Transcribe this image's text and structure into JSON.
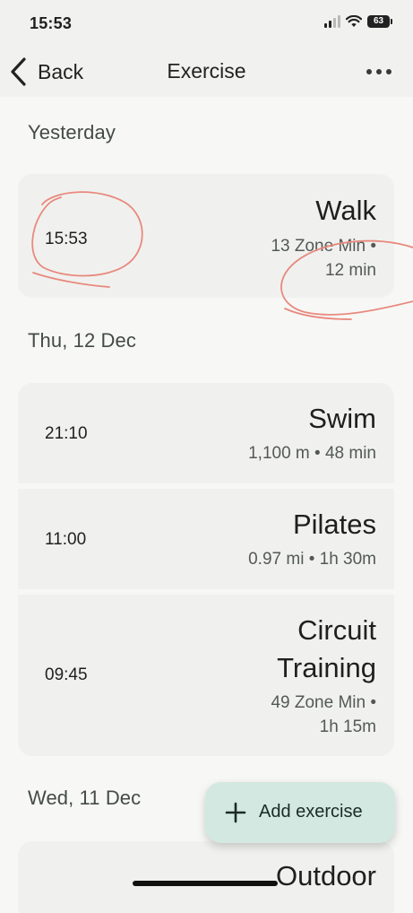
{
  "status_bar": {
    "time": "15:53",
    "battery": "63"
  },
  "header": {
    "back_label": "Back",
    "title": "Exercise"
  },
  "sections": [
    {
      "label": "Yesterday",
      "items": [
        {
          "time": "15:53",
          "name_lines": [
            "Walk"
          ],
          "meta_lines": [
            "13 Zone Min •",
            "12 min"
          ]
        }
      ]
    },
    {
      "label": "Thu, 12 Dec",
      "items": [
        {
          "time": "21:10",
          "name_lines": [
            "Swim"
          ],
          "meta_lines": [
            "1,100 m • 48 min"
          ]
        },
        {
          "time": "11:00",
          "name_lines": [
            "Pilates"
          ],
          "meta_lines": [
            "0.97 mi • 1h 30m"
          ]
        },
        {
          "time": "09:45",
          "name_lines": [
            "Circuit",
            "Training"
          ],
          "meta_lines": [
            "49 Zone Min •",
            "1h 15m"
          ]
        }
      ]
    },
    {
      "label": "Wed, 11 Dec",
      "items": [
        {
          "name_lines": [
            "Outdoor"
          ]
        }
      ]
    }
  ],
  "fab": {
    "label": "Add exercise"
  },
  "colors": {
    "background": "#f7f8f6",
    "card": "#f0f1ee",
    "fab": "#d2e8e1",
    "annotation": "#e8897e"
  }
}
